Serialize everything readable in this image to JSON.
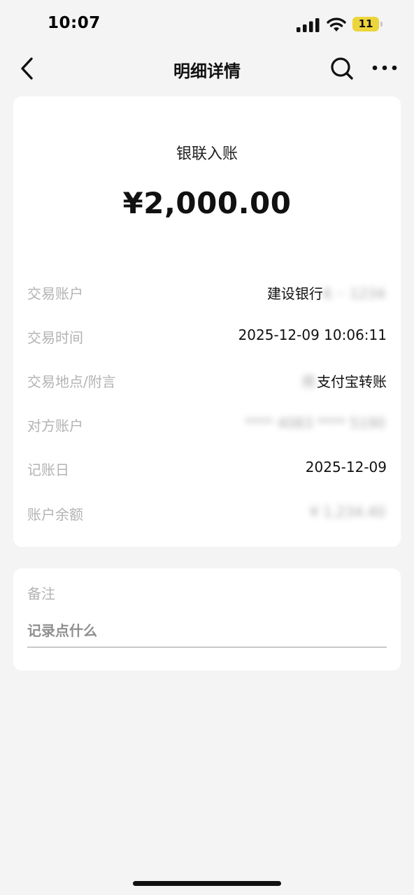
{
  "status_bar": {
    "time": "10:07",
    "battery_level": "11",
    "signal": "signal-icon",
    "wifi": "wifi-icon",
    "battery_color": "#ecd53b"
  },
  "nav": {
    "title": "明细详情",
    "back_icon": "chevron-left-icon",
    "search_icon": "search-icon",
    "more_icon": "more-horizontal-icon"
  },
  "transaction": {
    "type": "银联入账",
    "amount": "¥2,000.00",
    "rows": [
      {
        "label": "交易账户",
        "value": "建设银行"
      },
      {
        "label": "交易时间",
        "value": "2025-12-09 10:06:11"
      },
      {
        "label": "交易地点/附言",
        "value": "支付宝转账"
      },
      {
        "label": "对方账户",
        "value": ""
      },
      {
        "label": "记账日",
        "value": "2025-12-09"
      },
      {
        "label": "账户余额",
        "value": ""
      }
    ]
  },
  "note": {
    "title": "备注",
    "placeholder": "记录点什么"
  }
}
